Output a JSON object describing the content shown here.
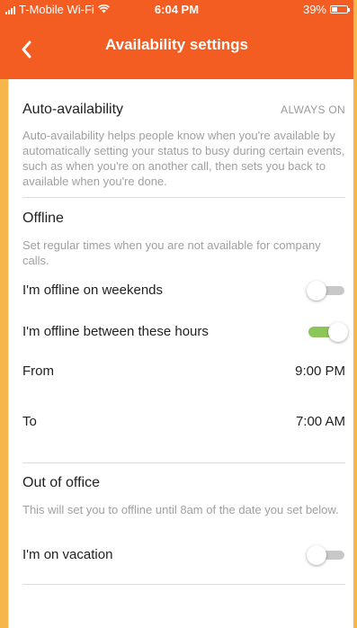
{
  "status_bar": {
    "carrier": "T-Mobile Wi-Fi",
    "time": "6:04 PM",
    "battery": "39%"
  },
  "app_bar": {
    "title": "Availability settings"
  },
  "auto_availability": {
    "title": "Auto-availability",
    "badge": "ALWAYS ON",
    "description": "Auto-availability helps people know when you're available by automatically setting your status to busy during certain events, such as when you're on another call, then sets you back to available when you're done."
  },
  "offline": {
    "title": "Offline",
    "description": "Set regular times when you are not available for company calls.",
    "weekends_label": "I'm offline on weekends",
    "weekends_on": false,
    "hours_label": "I'm offline between these hours",
    "hours_on": true,
    "from_label": "From",
    "from_value": "9:00 PM",
    "to_label": "To",
    "to_value": "7:00 AM"
  },
  "out_of_office": {
    "title": "Out of office",
    "description": "This will set you to offline until 8am of the date you set below.",
    "vacation_label": "I'm on vacation",
    "vacation_on": false
  },
  "colors": {
    "accent": "#f45d22",
    "toggle_on": "#8cc65a",
    "toggle_off": "#c8c8c8"
  }
}
